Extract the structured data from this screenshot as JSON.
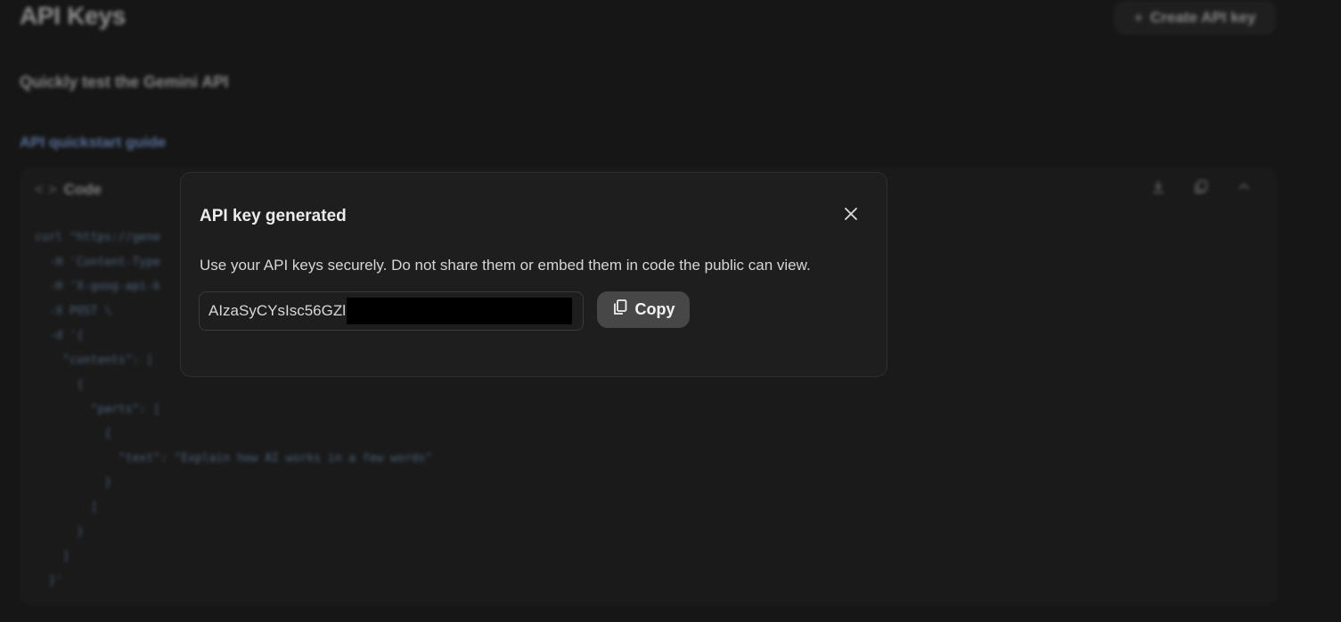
{
  "background": {
    "page_title": "API Keys",
    "create_button_label": "Create API key",
    "subtitle": "Quickly test the Gemini API",
    "quickstart_link": "API quickstart guide",
    "code_panel": {
      "header_label": "Code",
      "code_text": "curl \"https://gene\n  -H 'Content-Type\n  -H 'X-goog-api-k\n  -X POST \\\n  -d '{\n    \"contents\": [\n      {\n        \"parts\": [\n          {\n            \"text\": \"Explain how AI works in a few words\"\n          }\n        ]\n      }\n    ]\n  }'"
    }
  },
  "dialog": {
    "title": "API key generated",
    "description": "Use your API keys securely. Do not share them or embed them in code the public can view.",
    "key_visible_prefix": "AIzaSyCYsIsc56GZl",
    "copy_button_label": "Copy"
  },
  "colors": {
    "background": "#1b1b1b",
    "dialog_bg": "#1e1e1e",
    "link": "#8ab4f8",
    "copy_button_bg": "#474747"
  }
}
